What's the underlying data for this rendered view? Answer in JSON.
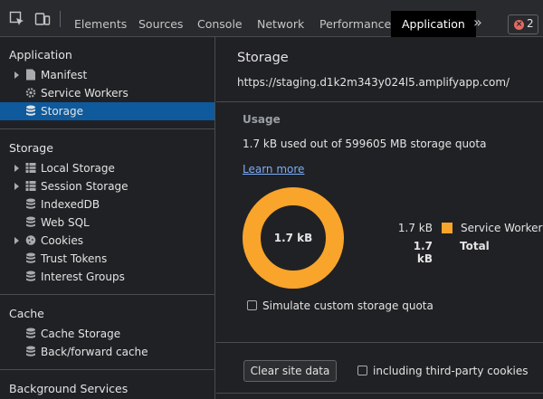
{
  "toolbar": {
    "tabs": [
      "Elements",
      "Sources",
      "Console",
      "Network",
      "Performance",
      "Application"
    ],
    "more": "»",
    "error_count": "2"
  },
  "sidebar": {
    "application": {
      "heading": "Application",
      "items": [
        {
          "label": "Manifest",
          "icon": "document-icon"
        },
        {
          "label": "Service Workers",
          "icon": "gear-icon"
        },
        {
          "label": "Storage",
          "icon": "database-icon"
        }
      ]
    },
    "storage": {
      "heading": "Storage",
      "items": [
        {
          "label": "Local Storage",
          "icon": "grid-icon"
        },
        {
          "label": "Session Storage",
          "icon": "grid-icon"
        },
        {
          "label": "IndexedDB",
          "icon": "database-icon"
        },
        {
          "label": "Web SQL",
          "icon": "database-icon"
        },
        {
          "label": "Cookies",
          "icon": "cookie-icon"
        },
        {
          "label": "Trust Tokens",
          "icon": "database-icon"
        },
        {
          "label": "Interest Groups",
          "icon": "database-icon"
        }
      ]
    },
    "cache": {
      "heading": "Cache",
      "items": [
        {
          "label": "Cache Storage",
          "icon": "database-icon"
        },
        {
          "label": "Back/forward cache",
          "icon": "database-icon"
        }
      ]
    },
    "background": {
      "heading": "Background Services"
    }
  },
  "main": {
    "title": "Storage",
    "origin": "https://staging.d1k2m343y024l5.amplifyapp.com/",
    "usage_heading": "Usage",
    "usage_text": "1.7 kB used out of 599605 MB storage quota",
    "learn_more": "Learn more",
    "donut_label": "1.7 kB",
    "legend": {
      "service_workers_value": "1.7 kB",
      "service_workers_label": "Service Workers",
      "service_workers_color": "#f9a42b",
      "total_value": "1.7 kB",
      "total_label": "Total"
    },
    "simulate_quota_label": "Simulate custom storage quota",
    "clear_button": "Clear site data",
    "third_party_label": "including third-party cookies"
  },
  "colors": {
    "accent_selected": "#0e5a9c",
    "link": "#7cacf8",
    "error": "#e46962"
  }
}
